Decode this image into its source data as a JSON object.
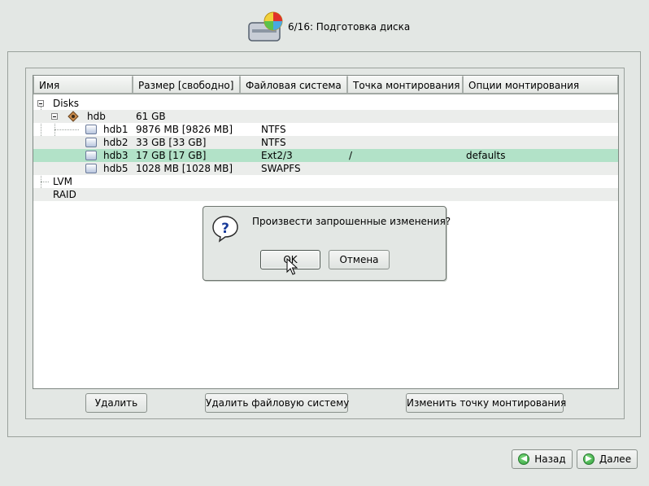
{
  "header": {
    "title": "6/16: Подготовка диска"
  },
  "table": {
    "columns": [
      "Имя",
      "Размер [свободно]",
      "Файловая система",
      "Точка монтирования",
      "Опции монтирования"
    ],
    "rows": [
      {
        "name": "Disks",
        "size": "",
        "fs": "",
        "mount": "",
        "options": ""
      },
      {
        "name": "hdb",
        "size": "61 GB",
        "fs": "",
        "mount": "",
        "options": ""
      },
      {
        "name": "hdb1",
        "size": "9876 MB [9826 MB]",
        "fs": "NTFS",
        "mount": "",
        "options": ""
      },
      {
        "name": "hdb2",
        "size": "33 GB [33 GB]",
        "fs": "NTFS",
        "mount": "",
        "options": ""
      },
      {
        "name": "hdb3",
        "size": "17 GB [17 GB]",
        "fs": "Ext2/3",
        "mount": "/",
        "options": "defaults"
      },
      {
        "name": "hdb5",
        "size": "1028 MB [1028 MB]",
        "fs": "SWAPFS",
        "mount": "",
        "options": ""
      },
      {
        "name": "LVM",
        "size": "",
        "fs": "",
        "mount": "",
        "options": ""
      },
      {
        "name": "RAID",
        "size": "",
        "fs": "",
        "mount": "",
        "options": ""
      }
    ]
  },
  "dialog": {
    "message": "Произвести запрошенные изменения?",
    "ok_label": "OK",
    "cancel_label": "Отмена"
  },
  "actions": {
    "delete_label": "Удалить",
    "delete_fs_label": "Удалить файловую систему",
    "change_mount_label": "Изменить точку монтирования"
  },
  "nav": {
    "back_label": "Назад",
    "next_label": "Далее"
  },
  "colors": {
    "selected_row": "#b2e2c8",
    "background": "#e3e7e4"
  }
}
